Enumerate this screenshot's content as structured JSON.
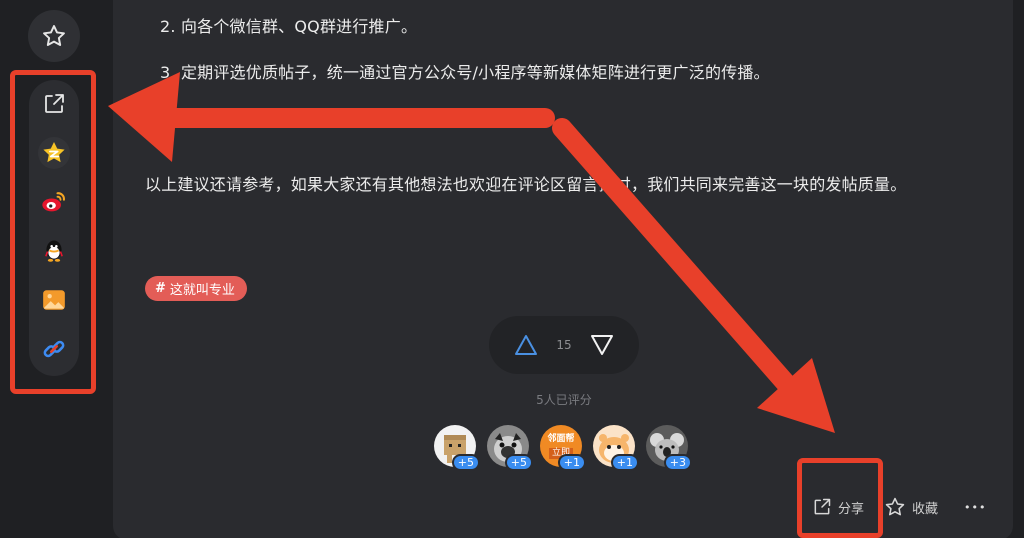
{
  "article": {
    "lines": [
      "2. 向各个微信群、QQ群进行推广。",
      "3. 定期评选优质帖子，统一通过官方公众号/小程序等新媒体矩阵进行更广泛的传播。",
      "以上建议还请参考，如果大家还有其他想法也欢迎在评论区留言探讨，我们共同来完善这一块的发帖质量。"
    ]
  },
  "tag": {
    "symbol": "#",
    "label": "这就叫专业"
  },
  "vote": {
    "count": "15"
  },
  "rating": {
    "text": "5人已评分"
  },
  "avatars": [
    {
      "icon": "cardboard-box-avatar",
      "badge": "+5"
    },
    {
      "icon": "pug-dog-avatar",
      "badge": "+5"
    },
    {
      "icon": "text-logo-avatar",
      "text_top": "邻面帮",
      "text_bottom": "立即",
      "badge": "+1"
    },
    {
      "icon": "cartoon-hamster-avatar",
      "badge": "+1"
    },
    {
      "icon": "koala-avatar",
      "badge": "+3"
    }
  ],
  "actions": {
    "share": "分享",
    "collect": "收藏",
    "more": "•••"
  },
  "share_panel": [
    "share-external-icon",
    "qzone-icon",
    "weibo-icon",
    "qq-icon",
    "image-icon",
    "link-icon"
  ],
  "colors": {
    "background": "#1f2023",
    "card": "#2a2b2f",
    "tag": "#e35d57",
    "annotation": "#e8402a",
    "upvote": "#4a90e2"
  }
}
